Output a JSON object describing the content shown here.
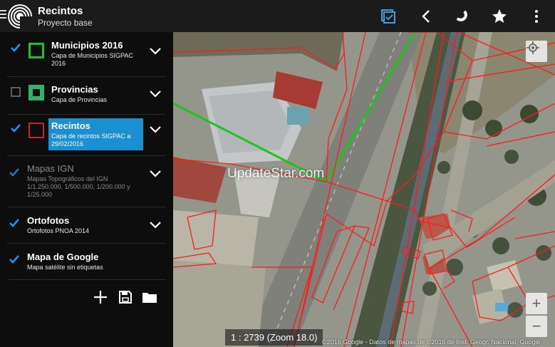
{
  "toolbar": {
    "title": "Recintos",
    "subtitle": "Proyecto base",
    "icons": [
      "menu-icon",
      "app-logo",
      "select-layers-icon",
      "back-icon",
      "magnet-icon",
      "star-icon",
      "overflow-menu-icon"
    ]
  },
  "layers": [
    {
      "name": "Municipios 2016",
      "desc": "Capa de Municipios SIGPAC 2016",
      "checked": true,
      "color": "#1ec41e",
      "enabled": true
    },
    {
      "name": "Provincias",
      "desc": "Capa de Provincias",
      "checked": false,
      "color": "#2fb36a",
      "enabled": true
    },
    {
      "name": "Recintos",
      "desc": "Capa de recintos SIGPAC a 29/02/2016",
      "checked": true,
      "color": "#d42020",
      "enabled": true,
      "selected": true
    },
    {
      "name": "Mapas IGN",
      "desc": "Mapas Topográficos del IGN 1/1.250.000, 1/500.000, 1/200.000 y 1/25.000",
      "checked": true,
      "enabled": false
    },
    {
      "name": "Ortofotos",
      "desc": "Ortofotos PNOA 2014",
      "checked": true,
      "enabled": true
    },
    {
      "name": "Mapa de Google",
      "desc": "Mapa satélite sin etiquetas",
      "checked": true,
      "enabled": true
    }
  ],
  "sidebar_actions": [
    "add-icon",
    "save-icon",
    "folder-icon"
  ],
  "map": {
    "scale_text": "1 : 2739 (Zoom 18.0)",
    "attribution": "©2016 Google - Datos de mapas de ©2016 de Inst. Geogr. Nacional, Google",
    "watermark": "UpdateStar.com",
    "zoom_in": "+",
    "zoom_out": "−"
  },
  "colors": {
    "accent": "#1a8fd1",
    "check": "#2196f3",
    "boundary_red": "#ff1a1a",
    "boundary_green": "#1ec41e"
  }
}
